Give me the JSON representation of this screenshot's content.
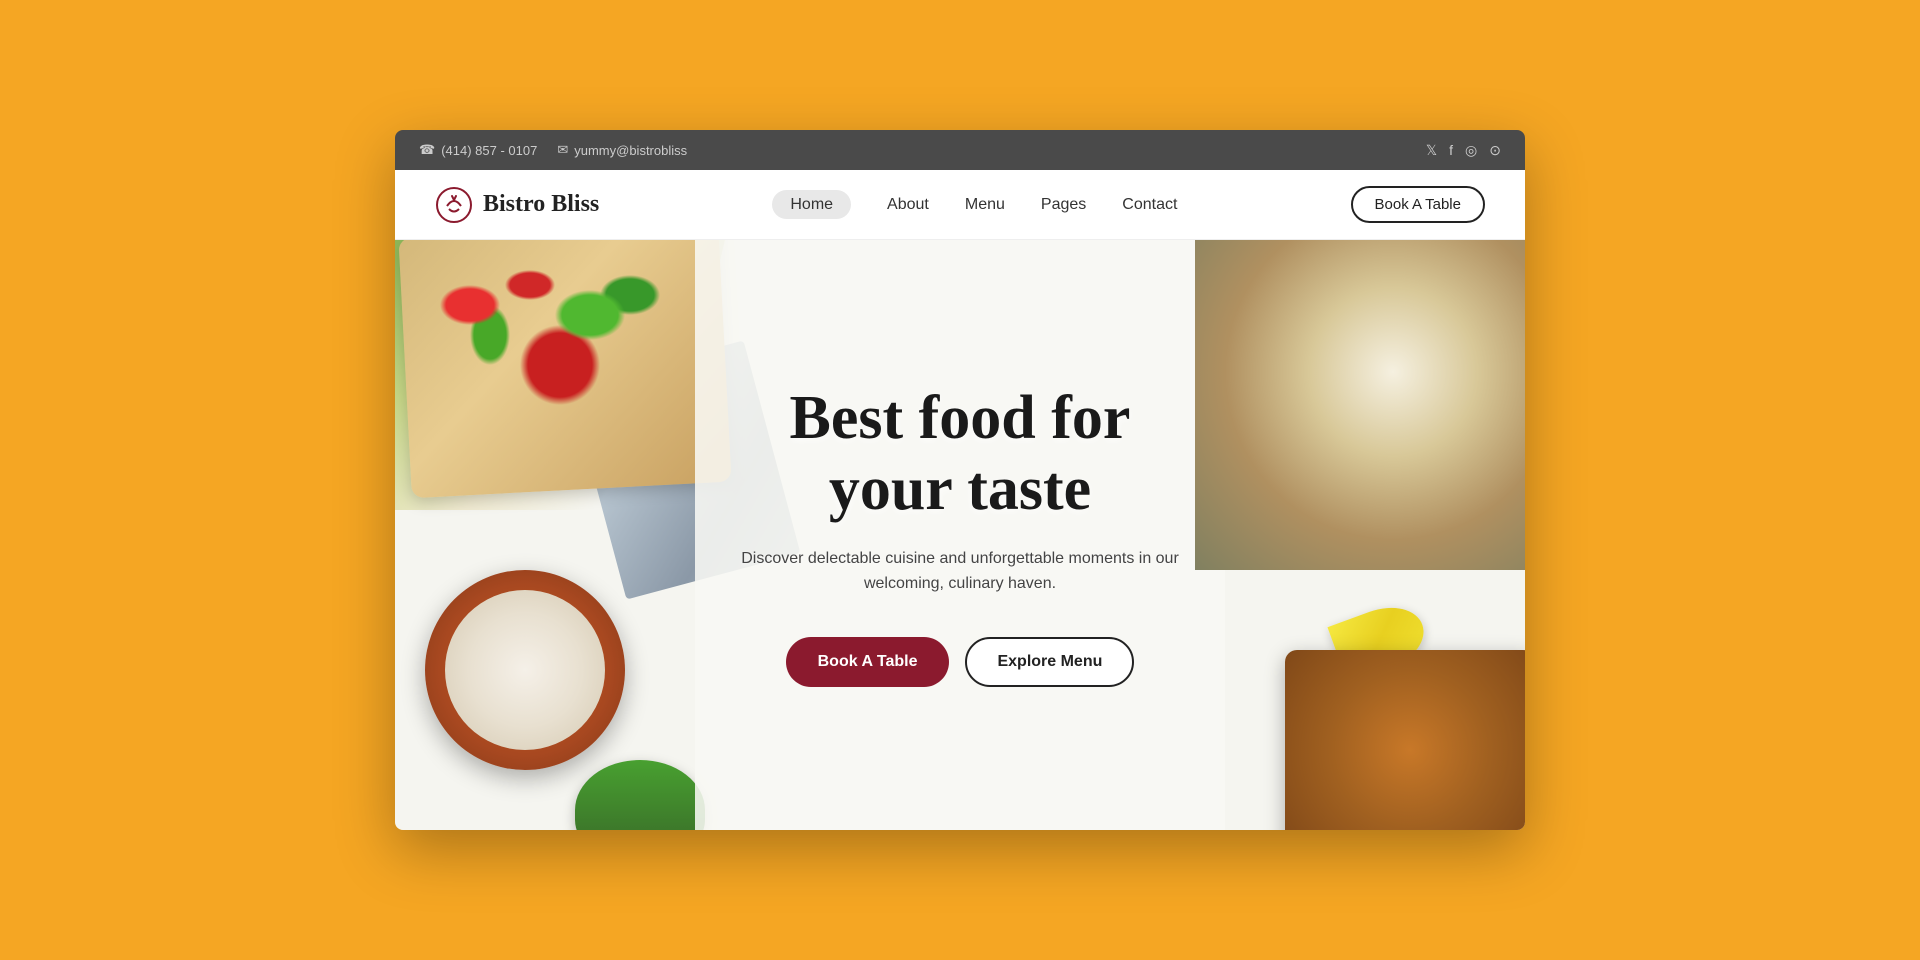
{
  "topBar": {
    "phone": "(414) 857 - 0107",
    "email": "yummy@bistrobliss",
    "socials": [
      "𝕏",
      "f",
      "◎",
      "⊙"
    ]
  },
  "navbar": {
    "logoText": "Bistro Bliss",
    "navLinks": [
      {
        "label": "Home",
        "active": true
      },
      {
        "label": "About",
        "active": false
      },
      {
        "label": "Menu",
        "active": false
      },
      {
        "label": "Pages",
        "active": false
      },
      {
        "label": "Contact",
        "active": false
      }
    ],
    "bookTableLabel": "Book A Table"
  },
  "hero": {
    "title": "Best food for your taste",
    "subtitle": "Discover delectable cuisine and unforgettable moments\nin our welcoming, culinary haven.",
    "bookTableBtn": "Book A Table",
    "exploreMenuBtn": "Explore Menu"
  }
}
